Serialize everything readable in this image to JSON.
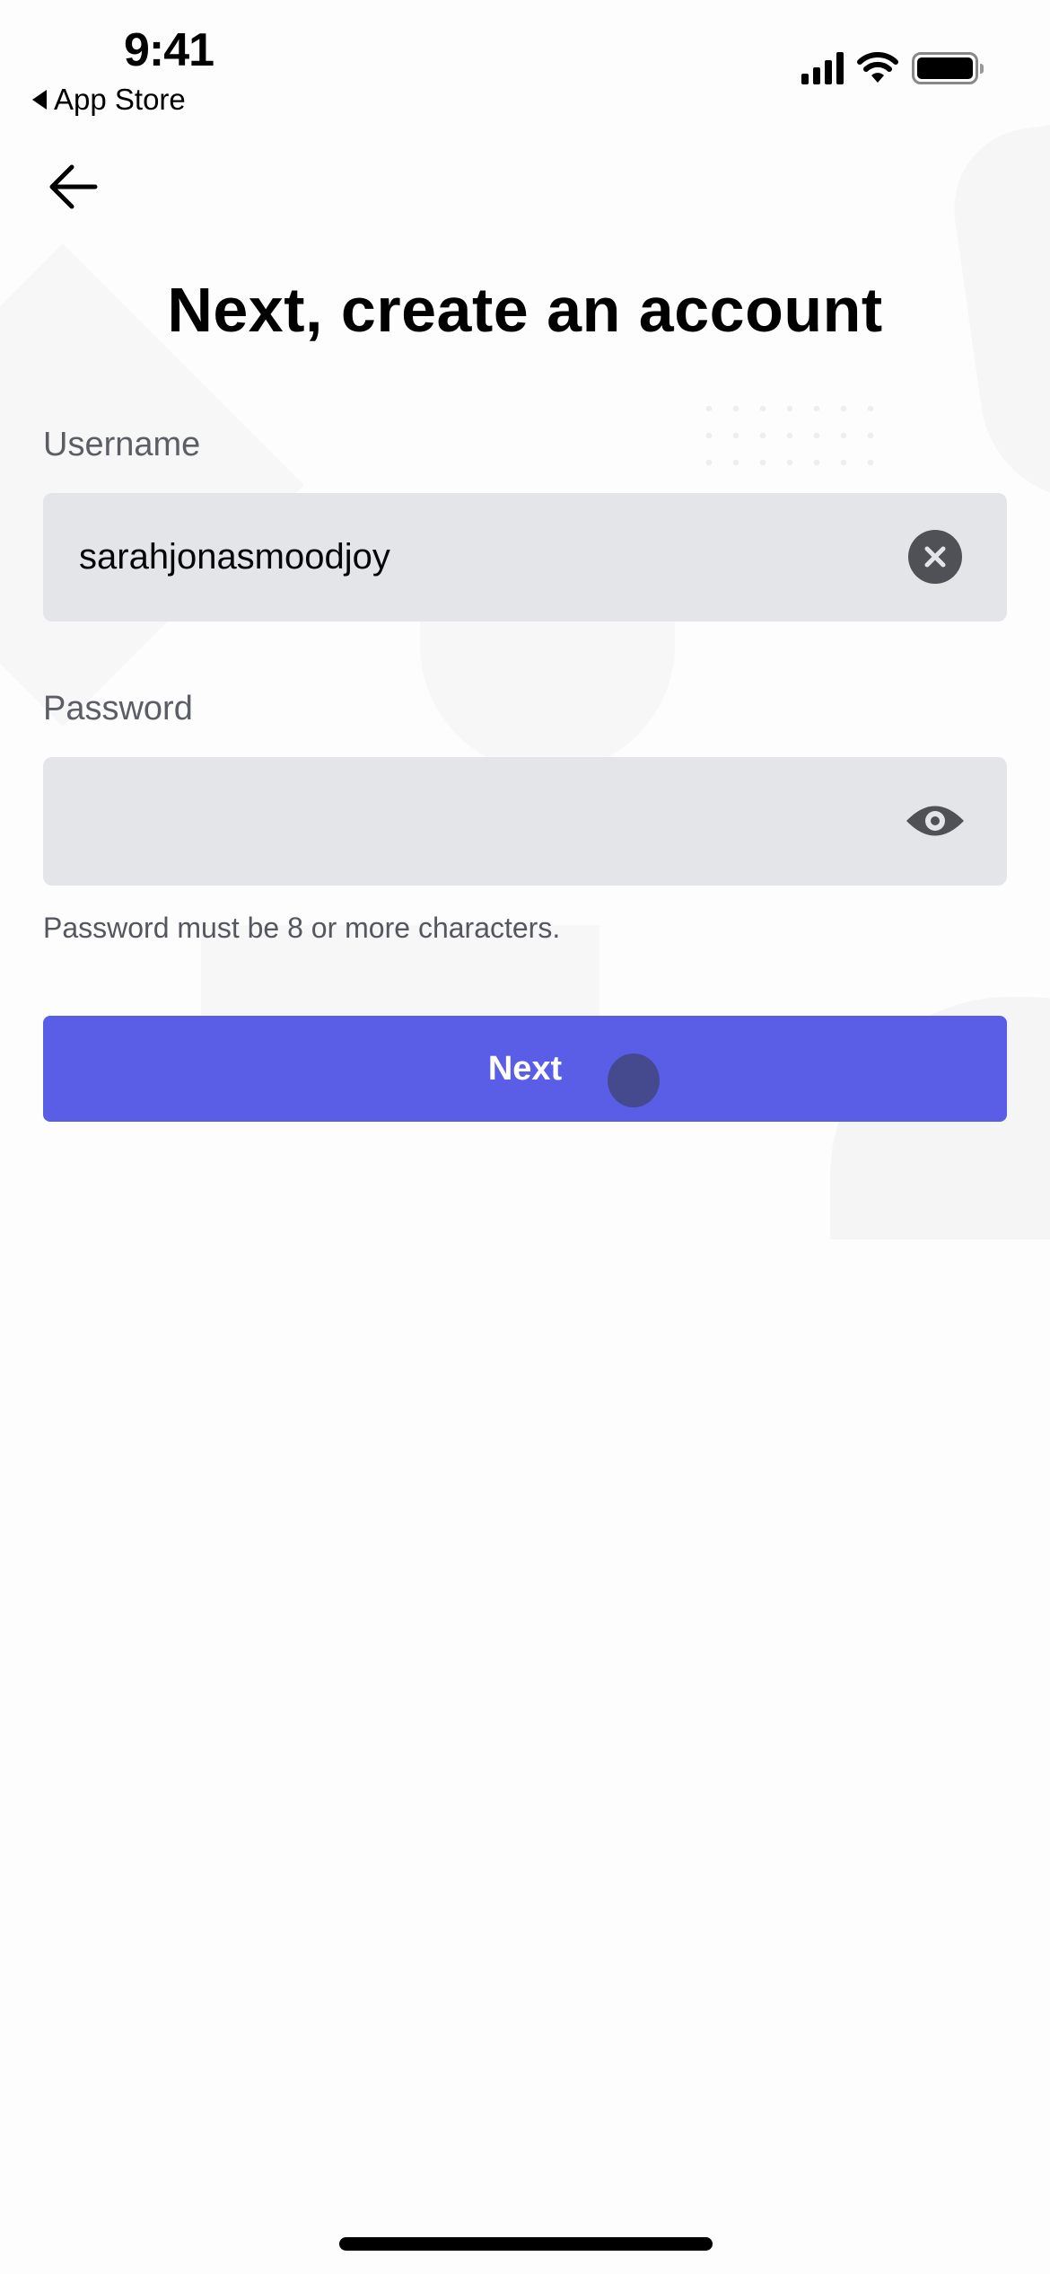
{
  "status_bar": {
    "time": "9:41",
    "back_app_label": "App Store",
    "icons": [
      "cellular-signal-icon",
      "wifi-icon",
      "battery-icon"
    ]
  },
  "nav": {
    "back_icon": "arrow-left-icon"
  },
  "page": {
    "title": "Next, create an account"
  },
  "form": {
    "username": {
      "label": "Username",
      "value": "sarahjonasmoodjoy",
      "clear_icon": "clear-circle-x-icon"
    },
    "password": {
      "label": "Password",
      "value": "",
      "toggle_icon": "eye-icon"
    },
    "password_hint": "Password must be 8 or more characters.",
    "submit_label": "Next"
  },
  "colors": {
    "primary": "#5a5ee6",
    "field_bg": "#e3e5e8",
    "label": "#5c5e66",
    "touch_indicator": "#454a8f"
  }
}
